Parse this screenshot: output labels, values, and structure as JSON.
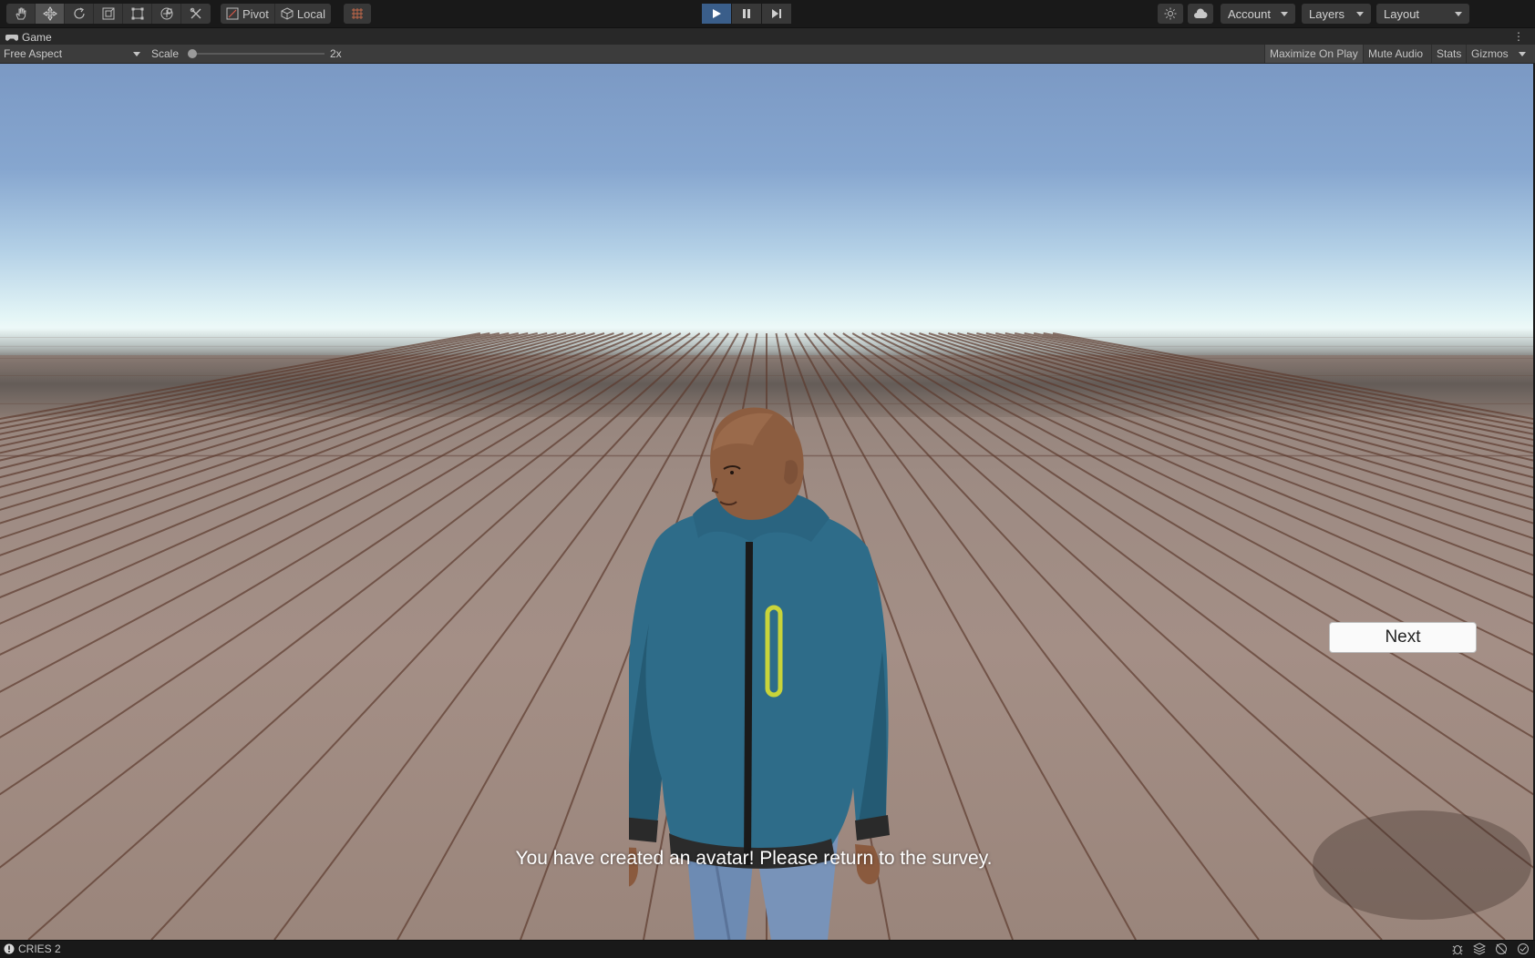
{
  "toolbar": {
    "tools": [
      {
        "name": "hand-tool",
        "icon": "hand-icon"
      },
      {
        "name": "move-tool",
        "icon": "move-icon"
      },
      {
        "name": "rotate-tool",
        "icon": "rotate-icon"
      },
      {
        "name": "scale-tool",
        "icon": "scale-icon"
      },
      {
        "name": "rect-tool",
        "icon": "rect-icon"
      },
      {
        "name": "transform-tool",
        "icon": "transform-icon"
      },
      {
        "name": "custom-tool",
        "icon": "custom-tool-icon"
      }
    ],
    "pivot_label": "Pivot",
    "local_label": "Local",
    "account_label": "Account",
    "layers_label": "Layers",
    "layout_label": "Layout"
  },
  "play_controls": {
    "play": "play-icon",
    "pause": "pause-icon",
    "step": "step-icon",
    "playing": true
  },
  "game_tab": {
    "title": "Game",
    "aspect": "Free Aspect",
    "scale_label": "Scale",
    "scale_value": "2x",
    "maximize_on_play": "Maximize On Play",
    "mute_audio": "Mute Audio",
    "stats": "Stats",
    "gizmos": "Gizmos"
  },
  "scene": {
    "next_button": "Next",
    "message": "You have created an avatar! Please return to the survey."
  },
  "status_bar": {
    "text": "CRIES 2"
  },
  "colors": {
    "play_active": "#3a5e8a",
    "toolbar_bg": "#191919",
    "jacket": "#2f6e8a",
    "zipper_accent": "#c9d43a"
  }
}
